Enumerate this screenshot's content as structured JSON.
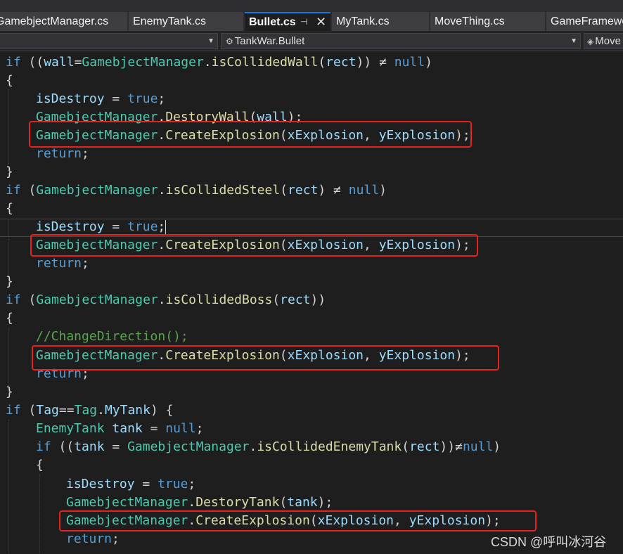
{
  "tabs": [
    {
      "label": "GamebjectManager.cs"
    },
    {
      "label": "EnemyTank.cs"
    },
    {
      "label": "Bullet.cs"
    },
    {
      "label": "MyTank.cs"
    },
    {
      "label": "MoveThing.cs"
    },
    {
      "label": "GameFramework.cs"
    }
  ],
  "nav": {
    "class_dropdown": "TankWar.Bullet",
    "member_dropdown": "Move"
  },
  "code": {
    "l1_if": "if",
    "l1_open": " ((",
    "l1_var": "wall",
    "l1_eq": "=",
    "l1_cls": "GamebjectManager",
    "l1_dot": ".",
    "l1_fn": "isCollidedWall",
    "l1_p1": "(",
    "l1_arg": "rect",
    "l1_p2": ")) ≠ ",
    "l1_null": "null",
    "l1_p3": ")",
    "brace_open": "{",
    "brace_close": "}",
    "isDestroy": "isDestroy",
    "assign": " = ",
    "true_kw": "true",
    "semi": ";",
    "manager": "GamebjectManager",
    "dot": ".",
    "destory_wall": "DestoryWall",
    "wall_arg": "wall",
    "create_explosion": "CreateExplosion",
    "paren_open": "(",
    "xExplosion": "xExplosion",
    "comma": ", ",
    "yExplosion": "yExplosion",
    "paren_close_semi": ");",
    "return_kw": "return",
    "steel_fn": "isCollidedSteel",
    "rect": "rect",
    "ne_null": ") ≠ ",
    "null_kw": "null",
    "close_paren": ")",
    "boss_fn": "isCollidedBoss",
    "close_double": "))",
    "comment": "//ChangeDirection();",
    "tag_cond": "Tag",
    "tag_eq": "==",
    "tag_cls": "Tag",
    "mytank": "MyTank",
    "tag_close": ") {",
    "enemytank_cls": "EnemyTank",
    "tank_var": "tank",
    "null_semi": ";",
    "enemy_fn": "isCollidedEnemyTank",
    "ne_null2": "))≠",
    "destory_tank": "DestoryTank"
  },
  "watermark": "CSDN @呼叫冰河谷",
  "colors": {
    "highlight_box": "#e8231f",
    "keyword": "#569cd6",
    "class": "#4ec9b0",
    "method": "#dcdcaa",
    "variable": "#9cdcfe",
    "comment": "#57a64a"
  }
}
